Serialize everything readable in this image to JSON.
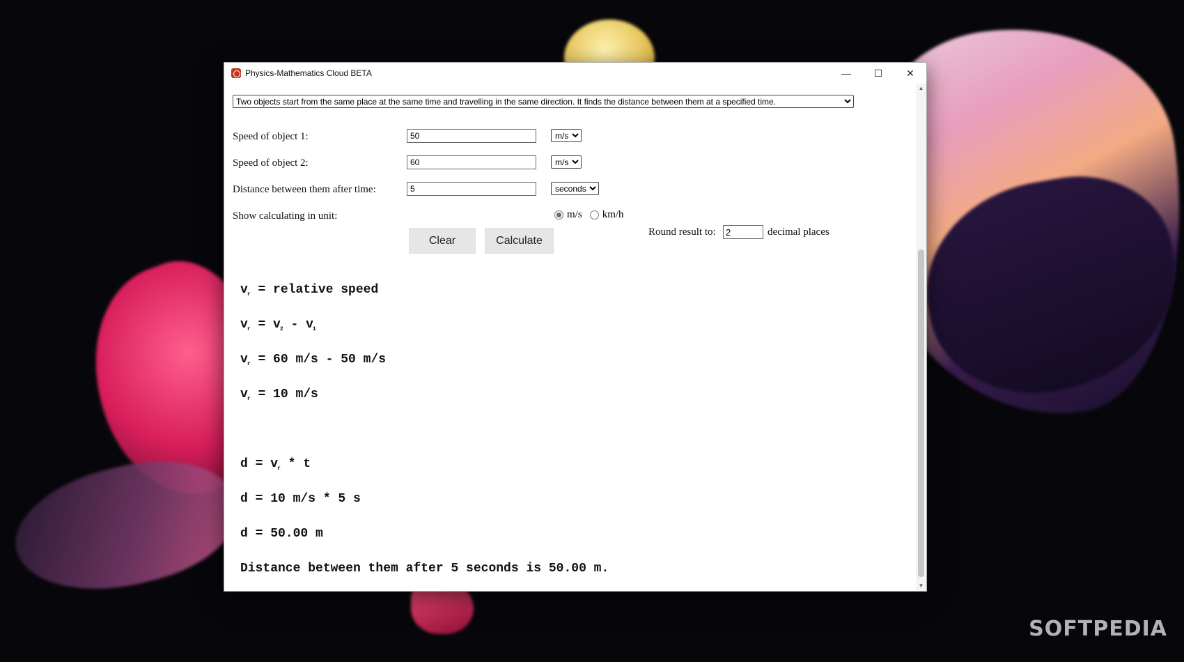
{
  "window": {
    "title": "Physics-Mathematics Cloud BETA",
    "minimize_glyph": "—",
    "maximize_glyph": "☐",
    "close_glyph": "✕"
  },
  "form": {
    "problem_option": "Two objects start from the same place at the same time and travelling in the same direction. It finds the distance between them at a specified time.",
    "speed1_label": "Speed of object 1:",
    "speed1_value": "50",
    "speed1_unit": "m/s",
    "speed2_label": "Speed of object 2:",
    "speed2_value": "60",
    "speed2_unit": "m/s",
    "time_label": "Distance between them after time:",
    "time_value": "5",
    "time_unit": "seconds",
    "show_unit_label": "Show calculating in unit:",
    "radio_ms": "m/s",
    "radio_kmh": "km/h",
    "clear_label": "Clear",
    "calculate_label": "Calculate",
    "round_label": "Round result to:",
    "round_value": "2",
    "round_suffix": "decimal places"
  },
  "calc": {
    "v": "v",
    "r": "r",
    "sub2": "2",
    "sub1": "1",
    "line1_rest": "= relative speed",
    "line2_eq": "= v",
    "line2_minus": "- v",
    "line3_rest": "= 60 m/s - 50 m/s",
    "line4_rest": "= 10 m/s",
    "line5_prefix": "d = v",
    "line5_suffix": "* t",
    "line6": "d = 10 m/s * 5 s",
    "line7": "d = 50.00 m",
    "result": "Distance between them after 5 seconds is 50.00 m."
  },
  "watermark": "SOFTPEDIA"
}
